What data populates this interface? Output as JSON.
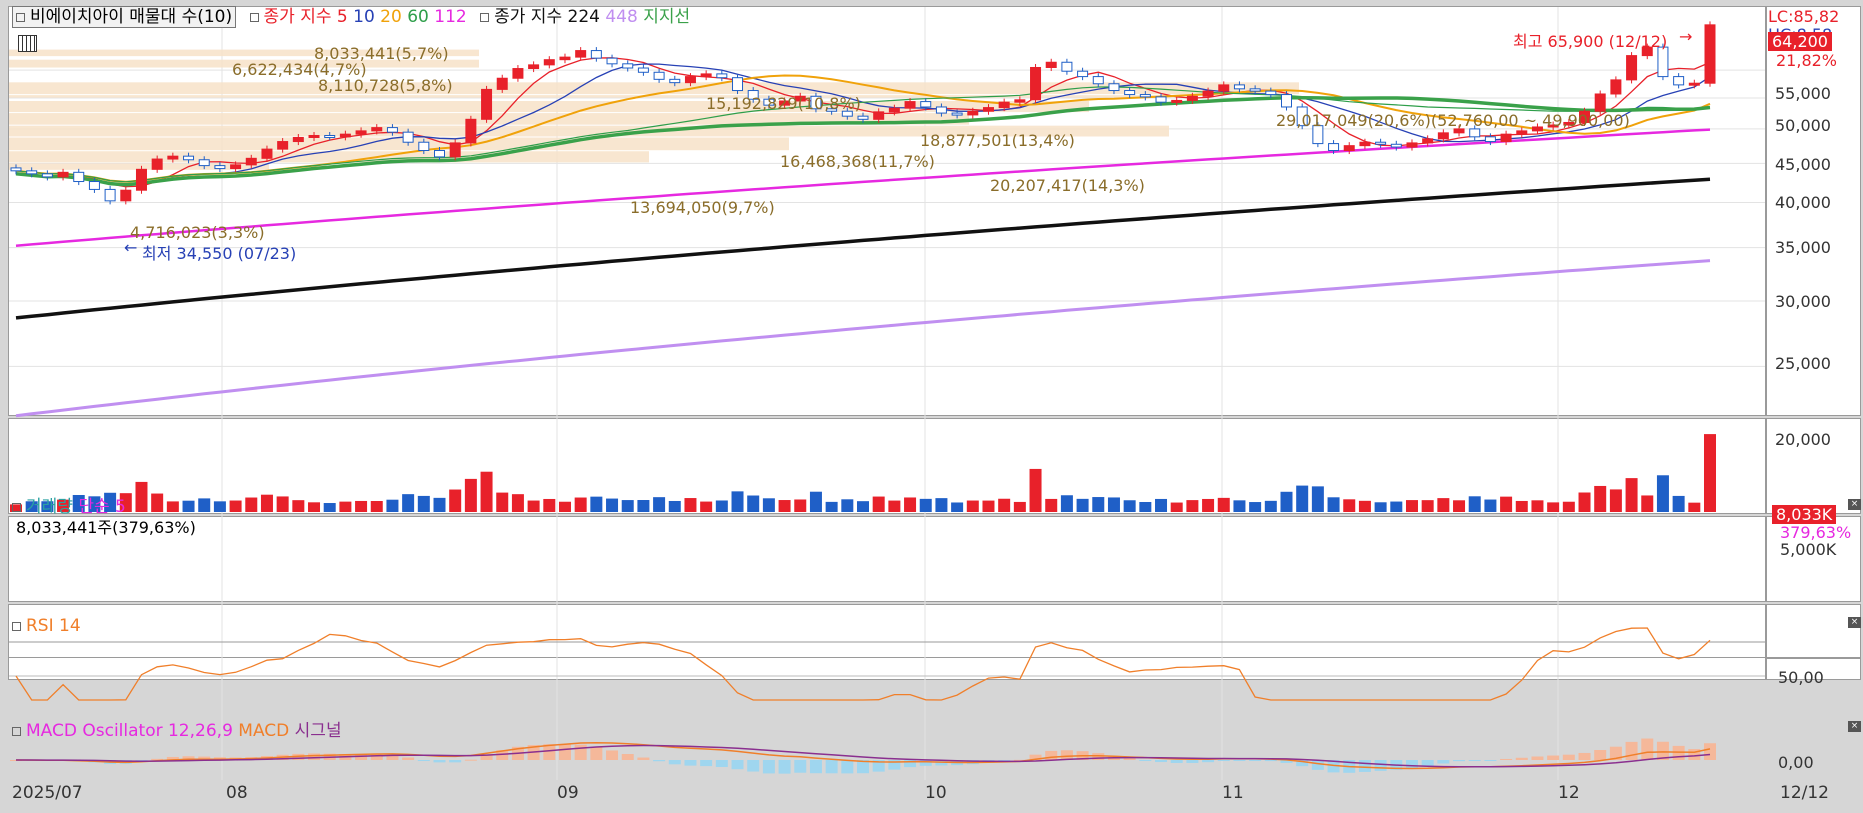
{
  "legend_price": {
    "stock_name": "비에이치아이 매물대 수(10)",
    "ma_label": "종가 지수",
    "ma_periods": [
      "5",
      "10",
      "20",
      "60",
      "112"
    ],
    "ma2_label": "종가 지수",
    "ma2_periods": [
      "224",
      "448"
    ],
    "support_label": "지지선"
  },
  "legend_volume": {
    "title": "거래량",
    "ma": "단순 5",
    "value": "8,033,441주(379,63%)"
  },
  "legend_rsi": {
    "title": "RSI 14"
  },
  "legend_macd": {
    "title": "MACD Oscillator 12,26,9",
    "macd": "MACD",
    "signal": "시그널"
  },
  "price_axis": {
    "ticks": [
      "55,000",
      "50,000",
      "45,000",
      "40,000",
      "35,000",
      "30,000",
      "25,000",
      "20,000"
    ]
  },
  "price_badges": {
    "lc": "LC:85,82",
    "hc": "HC:8,58",
    "current": "64,200",
    "pct": "21,82%"
  },
  "volume_axis": {
    "tick": "5,000K",
    "badge": "8,033K",
    "pct": "379,63%"
  },
  "rsi_axis": {
    "tick": "50,00"
  },
  "macd_axis": {
    "tick": "0,00"
  },
  "x_axis": {
    "labels": [
      "2025/07",
      "08",
      "09",
      "10",
      "11",
      "12"
    ],
    "last_date": "12/12"
  },
  "annotations": {
    "high": "최고 65,900 (12/12)",
    "low": "최저 34,550 (07/23)"
  },
  "volume_profile_labels": [
    "8,033,441(5,7%)",
    "6,622,434(4,7%)",
    "8,110,728(5,8%)",
    "15,192,829(10,8%)",
    "29,017,049(20,6%)(52,760,00 ~ 49,900,00)",
    "18,877,501(13,4%)",
    "16,468,368(11,7%)",
    "20,207,417(14,3%)",
    "13,694,050(9,7%)",
    "4,716,023(3,3%)"
  ],
  "colors": {
    "up": "#e8212a",
    "down": "#1f5fc7",
    "ma5": "#e8212a",
    "ma10": "#2741b5",
    "ma20": "#f0a20a",
    "ma60": "#2e9e4a",
    "ma112": "#e629e0",
    "ma224": "#111111",
    "ma448": "#c08ff0",
    "support": "#3aa14a",
    "profile": "#f7e2c8",
    "rsi": "#f07f2a",
    "macd": "#f07f2a",
    "signal": "#8a2f8f"
  },
  "chart_data": {
    "type": "candlestick",
    "x_dates": [
      "07/01",
      "12/12"
    ],
    "price_ylim": [
      17000,
      68000
    ],
    "high": 65900,
    "low": 34550,
    "close_last": 64200,
    "closes": [
      39000,
      38600,
      38200,
      38800,
      37600,
      36600,
      35200,
      36500,
      39200,
      40600,
      41000,
      40500,
      39700,
      39300,
      39800,
      40700,
      42000,
      43100,
      43700,
      44000,
      43800,
      44200,
      44700,
      45200,
      44500,
      43000,
      41800,
      40900,
      42900,
      46500,
      51500,
      53500,
      55300,
      56000,
      57000,
      57500,
      58800,
      57300,
      56200,
      55400,
      54600,
      53300,
      52700,
      53800,
      54300,
      53600,
      51300,
      49800,
      48800,
      49500,
      50300,
      48200,
      47800,
      47000,
      46500,
      47700,
      48300,
      49400,
      48500,
      47500,
      47200,
      47800,
      48400,
      49300,
      49700,
      55500,
      56500,
      54800,
      53800,
      52500,
      51300,
      50600,
      50200,
      49300,
      49600,
      50300,
      51200,
      52300,
      51600,
      51200,
      50600,
      48500,
      45500,
      42800,
      41800,
      42500,
      43000,
      42700,
      42300,
      42900,
      43500,
      44400,
      45000,
      43800,
      43100,
      44200,
      44700,
      45300,
      45600,
      46000,
      47800,
      50700,
      53200,
      57800,
      59500,
      53800,
      52300,
      52600,
      64200
    ],
    "volume_last": 8033441,
    "volume_pct": 379.63,
    "rsi_tick": 50,
    "macd_tick": 0
  }
}
